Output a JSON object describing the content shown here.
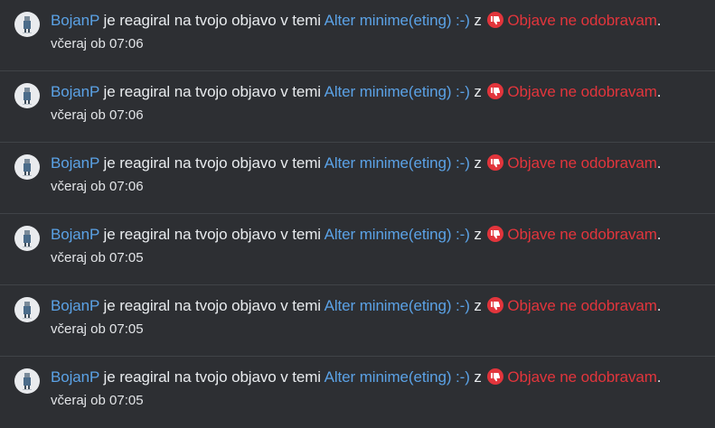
{
  "notifications": [
    {
      "user": "BojanP",
      "action": "je reagiral na tvojo objavo v temi",
      "topic": "Alter minime(eting) :-)",
      "connector": "z",
      "reaction": "Objave ne odobravam",
      "end": ".",
      "time": "včeraj ob 07:06",
      "reaction_icon": "thumbs-down-icon"
    },
    {
      "user": "BojanP",
      "action": "je reagiral na tvojo objavo v temi",
      "topic": "Alter minime(eting) :-)",
      "connector": "z",
      "reaction": "Objave ne odobravam",
      "end": ".",
      "time": "včeraj ob 07:06",
      "reaction_icon": "thumbs-down-icon"
    },
    {
      "user": "BojanP",
      "action": "je reagiral na tvojo objavo v temi",
      "topic": "Alter minime(eting) :-)",
      "connector": "z",
      "reaction": "Objave ne odobravam",
      "end": ".",
      "time": "včeraj ob 07:06",
      "reaction_icon": "thumbs-down-icon"
    },
    {
      "user": "BojanP",
      "action": "je reagiral na tvojo objavo v temi",
      "topic": "Alter minime(eting) :-)",
      "connector": "z",
      "reaction": "Objave ne odobravam",
      "end": ".",
      "time": "včeraj ob 07:05",
      "reaction_icon": "thumbs-down-icon"
    },
    {
      "user": "BojanP",
      "action": "je reagiral na tvojo objavo v temi",
      "topic": "Alter minime(eting) :-)",
      "connector": "z",
      "reaction": "Objave ne odobravam",
      "end": ".",
      "time": "včeraj ob 07:05",
      "reaction_icon": "thumbs-down-icon"
    },
    {
      "user": "BojanP",
      "action": "je reagiral na tvojo objavo v temi",
      "topic": "Alter minime(eting) :-)",
      "connector": "z",
      "reaction": "Objave ne odobravam",
      "end": ".",
      "time": "včeraj ob 07:05",
      "reaction_icon": "thumbs-down-icon"
    }
  ],
  "colors": {
    "background": "#2d2f33",
    "divider": "#404348",
    "text": "#e9ecef",
    "link": "#5ba2e6",
    "reaction": "#e2353c"
  }
}
